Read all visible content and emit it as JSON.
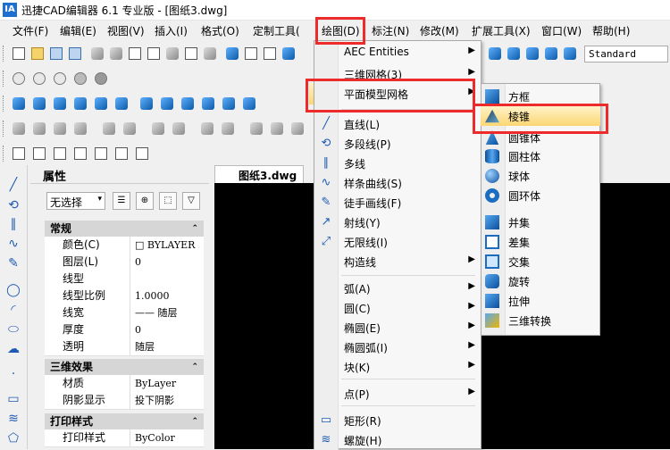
{
  "window": {
    "title": "迅捷CAD编辑器 6.1 专业版  - [图纸3.dwg]",
    "logo": "IA"
  },
  "menubar": {
    "items": [
      "文件(F)",
      "编辑(E)",
      "视图(V)",
      "插入(I)",
      "格式(O)",
      "定制工具(",
      "绘图(D)",
      "标注(N)",
      "修改(M)",
      "扩展工具(X)",
      "窗口(W)",
      "帮助(H)"
    ]
  },
  "toolbar": {
    "style_select": "Standard"
  },
  "properties": {
    "title": "属性",
    "selection": "无选择",
    "groups": [
      {
        "label": "常规",
        "rows": [
          {
            "key": "颜色(C)",
            "value": "□ BYLAYER"
          },
          {
            "key": "图层(L)",
            "value": "0"
          },
          {
            "key": "线型",
            "value": ""
          },
          {
            "key": "线型比例",
            "value": "1.0000"
          },
          {
            "key": "线宽",
            "value": "—— 随层"
          },
          {
            "key": "厚度",
            "value": "0"
          },
          {
            "key": "透明",
            "value": "随层"
          }
        ]
      },
      {
        "label": "三维效果",
        "rows": [
          {
            "key": "材质",
            "value": "ByLayer"
          },
          {
            "key": "阴影显示",
            "value": "投下阴影"
          }
        ]
      },
      {
        "label": "打印样式",
        "rows": [
          {
            "key": "打印样式",
            "value": "ByColor"
          }
        ]
      }
    ]
  },
  "document_tab": {
    "label": "图纸3.dwg"
  },
  "draw_menu": {
    "items": [
      {
        "label": "AEC Entities",
        "submenu": true
      },
      {
        "label": "三维网格(3)",
        "submenu": true
      },
      {
        "label": "平面模型网格",
        "submenu": true,
        "highlighted": true
      },
      {
        "label": "直线(L)"
      },
      {
        "label": "多段线(P)"
      },
      {
        "label": "多线"
      },
      {
        "label": "样条曲线(S)"
      },
      {
        "label": "徒手画线(F)"
      },
      {
        "label": "射线(Y)"
      },
      {
        "label": "无限线(I)"
      },
      {
        "label": "构造线",
        "submenu": true
      },
      {
        "label": "弧(A)",
        "submenu": true
      },
      {
        "label": "圆(C)",
        "submenu": true
      },
      {
        "label": "椭圆(E)",
        "submenu": true
      },
      {
        "label": "椭圆弧(I)",
        "submenu": true
      },
      {
        "label": "块(K)",
        "submenu": true
      },
      {
        "label": "点(P)",
        "submenu": true
      },
      {
        "label": "矩形(R)"
      },
      {
        "label": "螺旋(H)"
      }
    ]
  },
  "mesh_submenu": {
    "items": [
      {
        "label": "方框",
        "icon": "box-icon"
      },
      {
        "label": "棱锥",
        "icon": "pyramid-icon",
        "highlighted": true
      },
      {
        "label": "圆锥体",
        "icon": "cone-icon"
      },
      {
        "label": "圆柱体",
        "icon": "cylinder-icon"
      },
      {
        "label": "球体",
        "icon": "sphere-icon"
      },
      {
        "label": "圆环体",
        "icon": "torus-icon"
      },
      {
        "label": "并集",
        "icon": "union-icon"
      },
      {
        "label": "差集",
        "icon": "subtract-icon"
      },
      {
        "label": "交集",
        "icon": "intersect-icon"
      },
      {
        "label": "旋转",
        "icon": "revolve-icon"
      },
      {
        "label": "拉伸",
        "icon": "extrude-icon"
      },
      {
        "label": "三维转换",
        "icon": "convert-3d-icon"
      }
    ]
  },
  "colors": {
    "highlight": "#fbd773",
    "callout": "#ee2b2b",
    "canvas": "#000000"
  }
}
